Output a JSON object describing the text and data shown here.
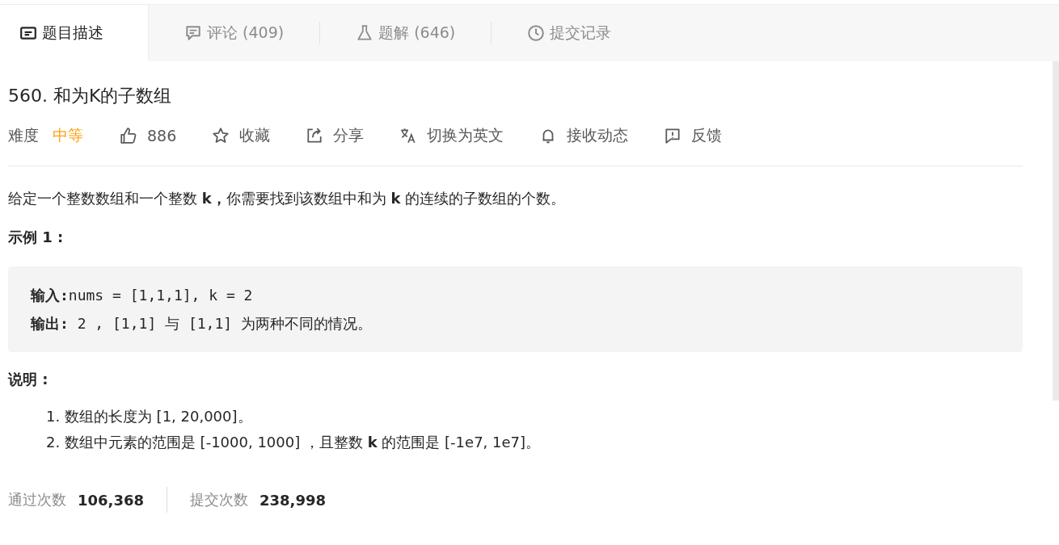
{
  "tabs": [
    {
      "label": "题目描述",
      "selected": true
    },
    {
      "label": "评论 (409)",
      "selected": false
    },
    {
      "label": "题解 (646)",
      "selected": false
    },
    {
      "label": "提交记录",
      "selected": false
    }
  ],
  "problem": {
    "title": "560. 和为K的子数组",
    "difficulty": {
      "label": "难度",
      "value": "中等"
    },
    "likes": "886",
    "actions": [
      "收藏",
      "分享",
      "切换为英文",
      "接收动态",
      "反馈"
    ],
    "description": "给定一个整数数组和一个整数 **k，**你需要找到该数组中和为 **k** 的连续的子数组的个数。",
    "example_heading": "示例 1 :",
    "example_lines": [
      "**输入:**nums = [1,1,1], k = 2",
      "**输出:** 2 , [1,1] 与 [1,1] 为两种不同的情况。"
    ],
    "notes_heading": "说明 :",
    "notes": [
      "1. 数组的长度为 [1, 20,000]。",
      "2. 数组中元素的范围是 [-1000, 1000] ，且整数 **k** 的范围是 [-1e7, 1e7]。"
    ]
  },
  "stats": [
    {
      "label": "通过次数",
      "value": "106,368"
    },
    {
      "label": "提交次数",
      "value": "238,998"
    }
  ]
}
